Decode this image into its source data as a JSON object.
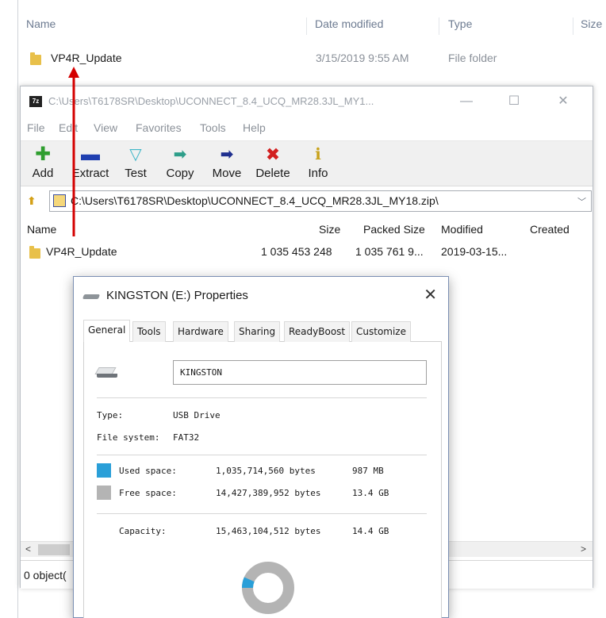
{
  "explorer": {
    "columns": {
      "name": "Name",
      "date_modified": "Date modified",
      "type": "Type",
      "size": "Size"
    },
    "row": {
      "name": "VP4R_Update",
      "date": "3/15/2019 9:55 AM",
      "type": "File folder"
    }
  },
  "sevenzip": {
    "app_icon": "7z",
    "title": "C:\\Users\\T6178SR\\Desktop\\UCONNECT_8.4_UCQ_MR28.3JL_MY1...",
    "menu": [
      "File",
      "Edit",
      "View",
      "Favorites",
      "Tools",
      "Help"
    ],
    "toolbar": [
      {
        "label": "Add",
        "icon": "add-plus-icon",
        "color": "#2f9e2f"
      },
      {
        "label": "Extract",
        "icon": "extract-minus-icon",
        "color": "#1f3fb0"
      },
      {
        "label": "Test",
        "icon": "test-check-icon",
        "color": "#3fb6c8"
      },
      {
        "label": "Copy",
        "icon": "copy-arrow-icon",
        "color": "#2e9e8a"
      },
      {
        "label": "Move",
        "icon": "move-arrow-icon",
        "color": "#1f2f8f"
      },
      {
        "label": "Delete",
        "icon": "delete-x-icon",
        "color": "#d21f1f"
      },
      {
        "label": "Info",
        "icon": "info-icon",
        "color": "#c8a21a"
      }
    ],
    "address": "C:\\Users\\T6178SR\\Desktop\\UCONNECT_8.4_UCQ_MR28.3JL_MY18.zip\\",
    "columns": {
      "name": "Name",
      "size": "Size",
      "packed_size": "Packed Size",
      "modified": "Modified",
      "created": "Created"
    },
    "row": {
      "name": "VP4R_Update",
      "size": "1 035 453 248",
      "packed_size": "1 035 761 9...",
      "modified": "2019-03-15..."
    },
    "status": "0 object("
  },
  "properties": {
    "title": "KINGSTON (E:) Properties",
    "tabs": [
      "General",
      "Tools",
      "Hardware",
      "Sharing",
      "ReadyBoost",
      "Customize"
    ],
    "active_tab": "General",
    "volume_name": "KINGSTON",
    "type_label": "Type:",
    "type_value": "USB Drive",
    "fs_label": "File system:",
    "fs_value": "FAT32",
    "used_label": "Used space:",
    "used_bytes": "1,035,714,560 bytes",
    "used_human": "987 MB",
    "free_label": "Free space:",
    "free_bytes": "14,427,389,952 bytes",
    "free_human": "13.4 GB",
    "capacity_label": "Capacity:",
    "capacity_bytes": "15,463,104,512 bytes",
    "capacity_human": "14.4 GB",
    "used_fraction": 0.067,
    "used_color": "#2a9fd8",
    "free_color": "#b4b4b4"
  },
  "annotation": {
    "arrow_color": "#d40000"
  }
}
